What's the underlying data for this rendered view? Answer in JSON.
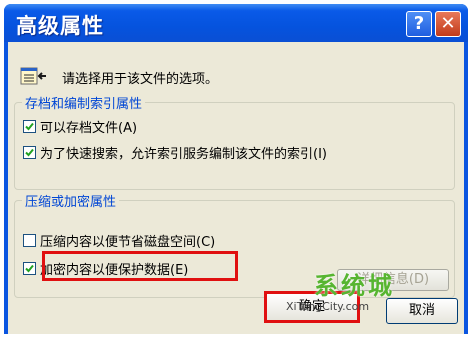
{
  "window": {
    "title": "高级属性",
    "help_label": "?",
    "close_label": "✕"
  },
  "intro_text": "请选择用于该文件的选项。",
  "archive_group": {
    "legend": "存档和编制索引属性",
    "options": [
      {
        "label": "可以存档文件(A)",
        "checked": true
      },
      {
        "label": "为了快速搜索，允许索引服务编制该文件的索引(I)",
        "checked": true
      }
    ]
  },
  "compress_group": {
    "legend": "压缩或加密属性",
    "options": [
      {
        "label": "压缩内容以便节省磁盘空间(C)",
        "checked": false
      },
      {
        "label": "加密内容以便保护数据(E)",
        "checked": true
      }
    ],
    "details_label": "详细信息(D)"
  },
  "buttons": {
    "ok_label": "确定",
    "cancel_label": "取消"
  },
  "watermark": {
    "brand": "系统城",
    "url": "XiTongCity.com"
  },
  "colors": {
    "title_bar": "#0553de",
    "dialog_bg": "#ece9d8",
    "legend_text": "#0046d5",
    "highlight_red": "#e01010",
    "watermark_green": "#57b531"
  },
  "icons": {
    "top": "file-arrow-icon",
    "help": "help-icon",
    "close": "close-icon",
    "check": "checkmark-icon"
  }
}
